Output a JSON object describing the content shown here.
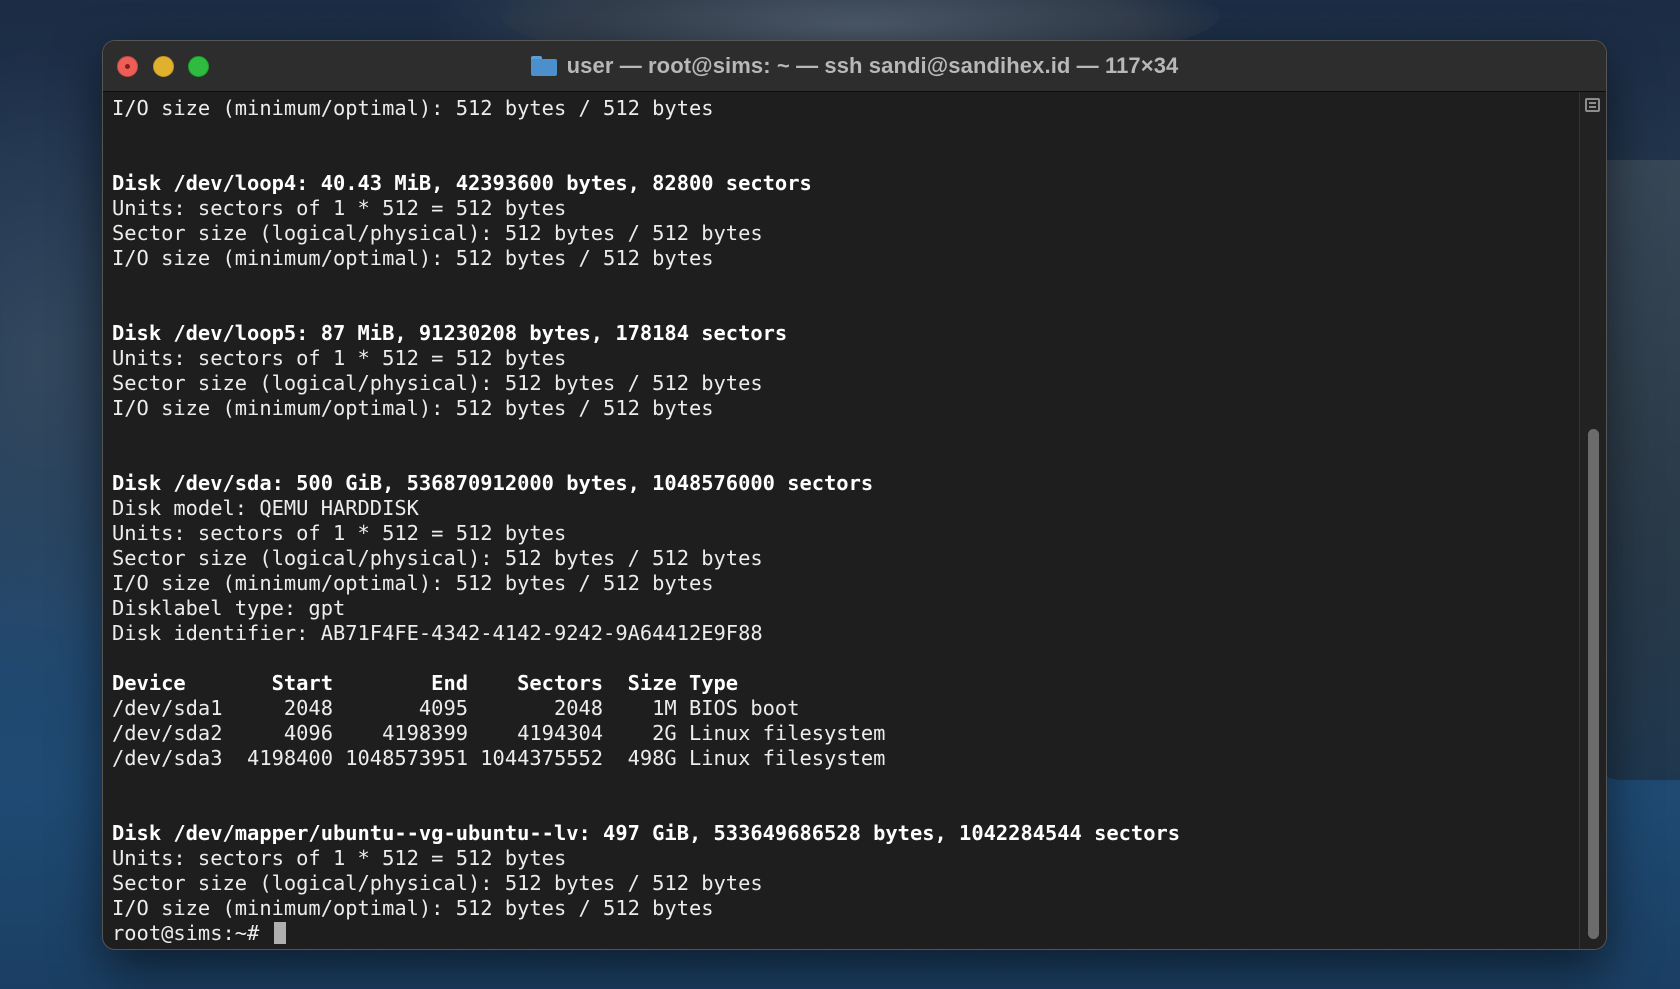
{
  "window": {
    "title": "user — root@sims: ~ — ssh sandi@sandihex.id — 117×34"
  },
  "terminal": {
    "lines": [
      {
        "text": "I/O size (minimum/optimal): 512 bytes / 512 bytes",
        "bold": false
      },
      {
        "text": "",
        "bold": false
      },
      {
        "text": "",
        "bold": false
      },
      {
        "text": "Disk /dev/loop4: 40.43 MiB, 42393600 bytes, 82800 sectors",
        "bold": true
      },
      {
        "text": "Units: sectors of 1 * 512 = 512 bytes",
        "bold": false
      },
      {
        "text": "Sector size (logical/physical): 512 bytes / 512 bytes",
        "bold": false
      },
      {
        "text": "I/O size (minimum/optimal): 512 bytes / 512 bytes",
        "bold": false
      },
      {
        "text": "",
        "bold": false
      },
      {
        "text": "",
        "bold": false
      },
      {
        "text": "Disk /dev/loop5: 87 MiB, 91230208 bytes, 178184 sectors",
        "bold": true
      },
      {
        "text": "Units: sectors of 1 * 512 = 512 bytes",
        "bold": false
      },
      {
        "text": "Sector size (logical/physical): 512 bytes / 512 bytes",
        "bold": false
      },
      {
        "text": "I/O size (minimum/optimal): 512 bytes / 512 bytes",
        "bold": false
      },
      {
        "text": "",
        "bold": false
      },
      {
        "text": "",
        "bold": false
      },
      {
        "text": "Disk /dev/sda: 500 GiB, 536870912000 bytes, 1048576000 sectors",
        "bold": true
      },
      {
        "text": "Disk model: QEMU HARDDISK",
        "bold": false
      },
      {
        "text": "Units: sectors of 1 * 512 = 512 bytes",
        "bold": false
      },
      {
        "text": "Sector size (logical/physical): 512 bytes / 512 bytes",
        "bold": false
      },
      {
        "text": "I/O size (minimum/optimal): 512 bytes / 512 bytes",
        "bold": false
      },
      {
        "text": "Disklabel type: gpt",
        "bold": false
      },
      {
        "text": "Disk identifier: AB71F4FE-4342-4142-9242-9A64412E9F88",
        "bold": false
      },
      {
        "text": "",
        "bold": false
      },
      {
        "text": "Device       Start        End    Sectors  Size Type",
        "bold": true
      },
      {
        "text": "/dev/sda1     2048       4095       2048    1M BIOS boot",
        "bold": false
      },
      {
        "text": "/dev/sda2     4096    4198399    4194304    2G Linux filesystem",
        "bold": false
      },
      {
        "text": "/dev/sda3  4198400 1048573951 1044375552  498G Linux filesystem",
        "bold": false
      },
      {
        "text": "",
        "bold": false
      },
      {
        "text": "",
        "bold": false
      },
      {
        "text": "Disk /dev/mapper/ubuntu--vg-ubuntu--lv: 497 GiB, 533649686528 bytes, 1042284544 sectors",
        "bold": true
      },
      {
        "text": "Units: sectors of 1 * 512 = 512 bytes",
        "bold": false
      },
      {
        "text": "Sector size (logical/physical): 512 bytes / 512 bytes",
        "bold": false
      },
      {
        "text": "I/O size (minimum/optimal): 512 bytes / 512 bytes",
        "bold": false
      }
    ],
    "prompt": "root@sims:~# "
  }
}
